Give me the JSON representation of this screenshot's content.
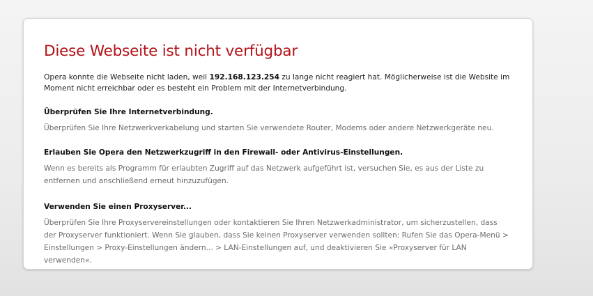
{
  "error": {
    "title": "Diese Webseite ist nicht verfügbar",
    "intro_before": "Opera konnte die Webseite nicht laden, weil ",
    "host": "192.168.123.254",
    "intro_after": " zu lange nicht reagiert hat. Möglicherweise ist die Website im Moment nicht erreichbar oder es besteht ein Problem mit der Internetverbindung."
  },
  "sections": [
    {
      "heading": "Überprüfen Sie Ihre Internetverbindung.",
      "text": "Überprüfen Sie Ihre Netzwerkverkabelung und starten Sie verwendete Router, Modems oder andere Netzwerkgeräte neu."
    },
    {
      "heading": "Erlauben Sie Opera den Netzwerkzugriff in den Firewall- oder Antivirus-Einstellungen.",
      "text": "Wenn es bereits als Programm für erlaubten Zugriff auf das Netzwerk aufgeführt ist, versuchen Sie, es aus der Liste zu entfernen und anschließend erneut hinzuzufügen."
    },
    {
      "heading": "Verwenden Sie einen Proxyserver...",
      "text": "Überprüfen Sie Ihre Proxyservereinstellungen oder kontaktieren Sie Ihren Netzwerkadministrator, um sicherzustellen, dass der Proxyserver funktioniert. Wenn Sie glauben, dass Sie keinen Proxyserver verwenden sollten: Rufen Sie das Opera-Menü > Einstellungen > Proxy-Einstellungen ändern... > LAN-Einstellungen auf, und deaktivieren Sie »Proxyserver für LAN verwenden«."
    }
  ],
  "colors": {
    "title": "#b31217",
    "body_text": "#1e1e1e",
    "muted_text": "#6b6b6b",
    "card_background": "#ffffff",
    "page_background": "#ececec"
  }
}
